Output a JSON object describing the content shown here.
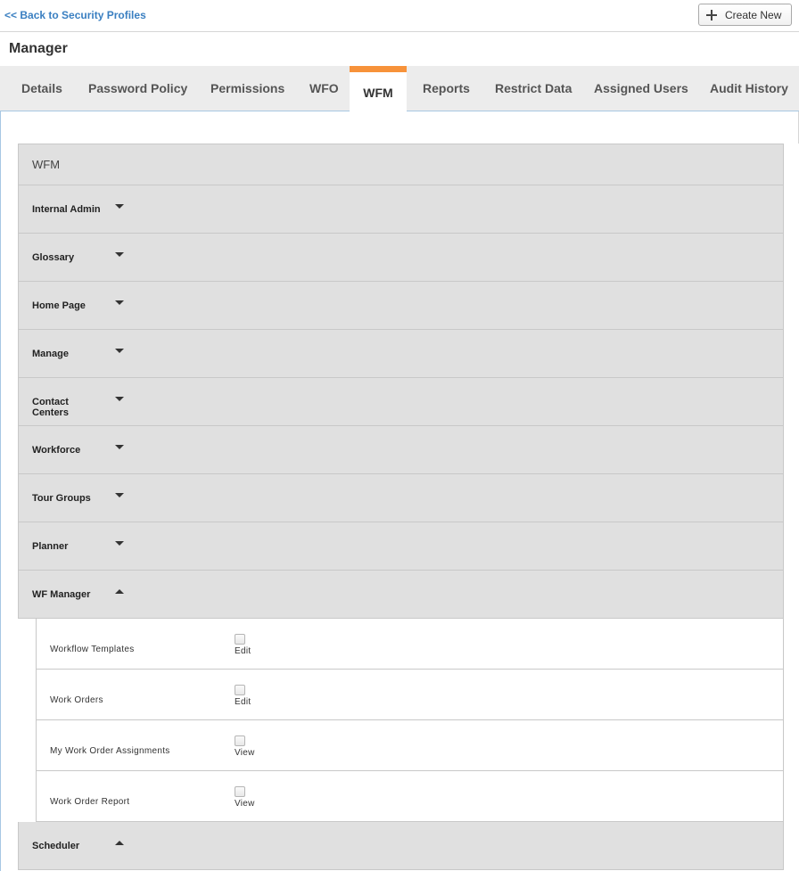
{
  "header": {
    "back_link": "<< Back to Security Profiles",
    "create_new": "Create New",
    "create_icon": "plus-icon"
  },
  "page_title": "Manager",
  "tabs": [
    {
      "label": "Details",
      "active": false
    },
    {
      "label": "Password Policy",
      "active": false
    },
    {
      "label": "Permissions",
      "active": false
    },
    {
      "label": "WFO",
      "active": false
    },
    {
      "label": "WFM",
      "active": true
    },
    {
      "label": "Reports",
      "active": false
    },
    {
      "label": "Restrict Data",
      "active": false
    },
    {
      "label": "Assigned Users",
      "active": false
    },
    {
      "label": "Audit History",
      "active": false
    }
  ],
  "panel": {
    "title": "WFM",
    "sections": [
      {
        "label": "Internal Admin",
        "expanded": false
      },
      {
        "label": "Glossary",
        "expanded": false
      },
      {
        "label": "Home Page",
        "expanded": false
      },
      {
        "label": "Manage",
        "expanded": false
      },
      {
        "label": "Contact Centers",
        "expanded": false
      },
      {
        "label": "Workforce",
        "expanded": false
      },
      {
        "label": "Tour Groups",
        "expanded": false
      },
      {
        "label": "Planner",
        "expanded": false
      },
      {
        "label": "WF Manager",
        "expanded": true
      },
      {
        "label": "Scheduler",
        "expanded": true
      }
    ],
    "wf_manager_items": [
      {
        "label": "Workflow Templates",
        "permission": "Edit",
        "checked": false
      },
      {
        "label": "Work Orders",
        "permission": "Edit",
        "checked": false
      },
      {
        "label": "My Work Order Assignments",
        "permission": "View",
        "checked": false
      },
      {
        "label": "Work Order Report",
        "permission": "View",
        "checked": false
      }
    ]
  },
  "colors": {
    "active_tab_accent": "#f7923a",
    "link": "#3a7fc1",
    "section_bg": "#e0e0e0"
  }
}
